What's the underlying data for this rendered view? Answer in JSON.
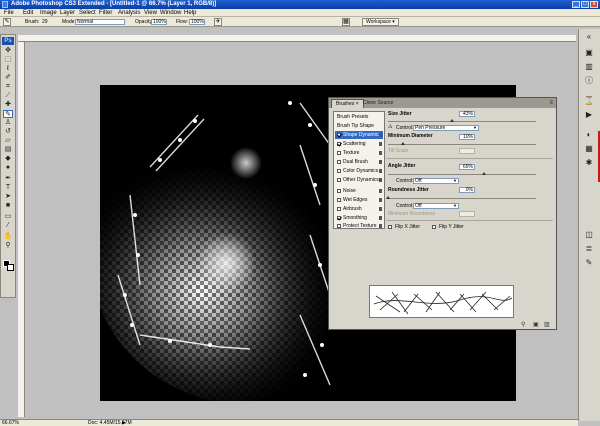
{
  "window": {
    "title": "Adobe Photoshop CS3 Extended - [Untitled-1 @ 66.7% (Layer 1, RGB/8)]",
    "controls": [
      "_",
      "□",
      "x"
    ]
  },
  "menu": [
    "File",
    "Edit",
    "Image",
    "Layer",
    "Select",
    "Filter",
    "Analysis",
    "View",
    "Window",
    "Help"
  ],
  "options_bar": {
    "brush_label": "Brush:",
    "brush_size": "29",
    "mode_label": "Mode:",
    "mode_value": "Normal",
    "opacity_label": "Opacity:",
    "opacity_value": "100%",
    "flow_label": "Flow:",
    "flow_value": "100%",
    "workspace_label": "Workspace ▾"
  },
  "tools_panel": {
    "badge": "Ps",
    "tools": [
      "move-icon",
      "marquee-icon",
      "lasso-icon",
      "quick-select-icon",
      "crop-icon",
      "slice-icon",
      "healing-icon",
      "brush-icon",
      "clone-stamp-icon",
      "history-brush-icon",
      "eraser-icon",
      "gradient-icon",
      "blur-icon",
      "dodge-icon",
      "pen-icon",
      "type-icon",
      "path-select-icon",
      "shape-icon",
      "notes-icon",
      "eyedropper-icon",
      "hand-icon",
      "zoom-icon"
    ],
    "active_tool": "brush-icon",
    "foreground_color": "#000000",
    "background_color": "#ffffff"
  },
  "status_bar": {
    "zoom": "66.67%",
    "doc_size": "Doc: 4.45M/15.67M",
    "arrow": "▶"
  },
  "brushes_panel": {
    "tabs": [
      "Brushes ×",
      "Clone Source"
    ],
    "menu_icon": "≡",
    "list": [
      {
        "label": "Brush Presets",
        "checkbox": false,
        "lock": false,
        "selected": false
      },
      {
        "label": "Brush Tip Shape",
        "checkbox": false,
        "lock": false,
        "selected": false
      },
      {
        "label": "Shape Dynamics",
        "checkbox": true,
        "checked": true,
        "lock": true,
        "selected": true
      },
      {
        "label": "Scattering",
        "checkbox": true,
        "checked": true,
        "lock": true,
        "selected": false
      },
      {
        "label": "Texture",
        "checkbox": true,
        "checked": false,
        "lock": true,
        "selected": false
      },
      {
        "label": "Dual Brush",
        "checkbox": true,
        "checked": false,
        "lock": true,
        "selected": false
      },
      {
        "label": "Color Dynamics",
        "checkbox": true,
        "checked": false,
        "lock": true,
        "selected": false
      },
      {
        "label": "Other Dynamics",
        "checkbox": true,
        "checked": false,
        "lock": true,
        "selected": false
      },
      {
        "label": "Noise",
        "checkbox": true,
        "checked": false,
        "lock": true,
        "selected": false
      },
      {
        "label": "Wet Edges",
        "checkbox": true,
        "checked": false,
        "lock": true,
        "selected": false
      },
      {
        "label": "Airbrush",
        "checkbox": true,
        "checked": false,
        "lock": true,
        "selected": false
      },
      {
        "label": "Smoothing",
        "checkbox": true,
        "checked": true,
        "lock": true,
        "selected": false
      },
      {
        "label": "Protect Texture",
        "checkbox": true,
        "checked": false,
        "lock": true,
        "selected": false
      }
    ],
    "size_jitter": {
      "label": "Size Jitter",
      "value": "43%",
      "level": 0.43
    },
    "size_control": {
      "label": "Control:",
      "value": "Pen Pressure"
    },
    "minimum_diameter": {
      "label": "Minimum Diameter",
      "value": "10%",
      "level": 0.1
    },
    "tilt_scale": {
      "label": "Tilt Scale"
    },
    "angle_jitter": {
      "label": "Angle Jitter",
      "value": "65%",
      "level": 0.65
    },
    "angle_control": {
      "label": "Control:",
      "value": "Off"
    },
    "roundness_jitter": {
      "label": "Roundness Jitter",
      "value": "0%",
      "level": 0.0
    },
    "roundness_control": {
      "label": "Control:",
      "value": "Off"
    },
    "minimum_roundness": {
      "label": "Minimum Roundness"
    },
    "flip_x": {
      "label": "Flip X Jitter",
      "checked": false
    },
    "flip_y": {
      "label": "Flip Y Jitter",
      "checked": false
    },
    "footer_icons": [
      "brush-pin-icon",
      "new-brush-icon",
      "delete-brush-icon"
    ]
  },
  "dock": [
    "collapse-arrow-icon",
    "navigator-icon",
    "histogram-icon",
    "info-icon",
    "history-icon",
    "actions-icon",
    "color-icon",
    "swatches-icon",
    "styles-icon",
    "layers-icon",
    "channels-icon",
    "paths-icon"
  ]
}
